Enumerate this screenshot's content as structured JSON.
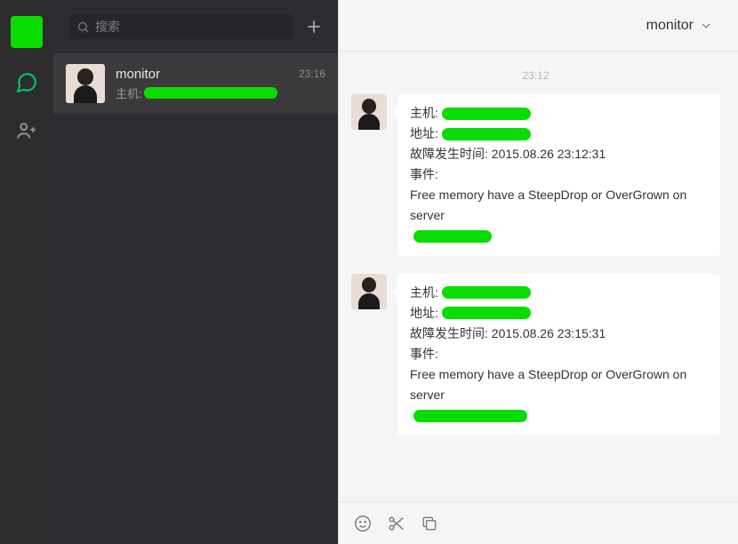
{
  "nav": {
    "active": "chat"
  },
  "search": {
    "placeholder": "搜索"
  },
  "conversations": [
    {
      "name": "monitor",
      "time": "23:16",
      "preview_prefix": "主机:"
    }
  ],
  "chat": {
    "header_name": "monitor",
    "time_divider": "23:12",
    "messages": [
      {
        "host_label": "主机:",
        "addr_label": "地址:",
        "fault_time_label": "故障发生时间:",
        "fault_time_value": "2015.08.26 23:12:31",
        "event_label": "事件:",
        "event_text": "Free memory have a SteepDrop or OverGrown on server"
      },
      {
        "host_label": "主机:",
        "addr_label": "地址:",
        "fault_time_label": "故障发生时间:",
        "fault_time_value": "2015.08.26 23:15:31",
        "event_label": "事件:",
        "event_text": "Free memory have a SteepDrop or OverGrown on server"
      }
    ]
  }
}
